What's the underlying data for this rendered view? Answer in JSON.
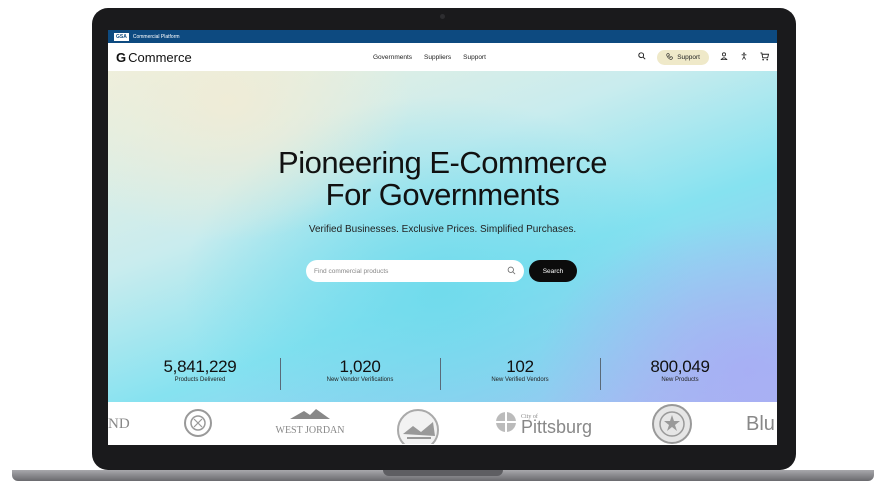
{
  "banner": {
    "badge": "GSA",
    "text": "Commercial Platform"
  },
  "nav": {
    "logo_mark": "G",
    "logo_text": "Commerce",
    "links": [
      "Governments",
      "Suppliers",
      "Support"
    ],
    "search_icon": "search-icon",
    "support_label": "Support",
    "icons": [
      "phone-icon",
      "user-icon",
      "accessibility-icon",
      "cart-icon"
    ]
  },
  "hero": {
    "title_line1": "Pioneering E-Commerce",
    "title_line2": "For Governments",
    "subtitle": "Verified Businesses. Exclusive Prices. Simplified Purchases.",
    "search_placeholder": "Find commercial products",
    "search_button": "Search"
  },
  "stats": [
    {
      "value": "5,841,229",
      "label": "Products Delivered"
    },
    {
      "value": "1,020",
      "label": "New Vendor Verifications"
    },
    {
      "value": "102",
      "label": "New Verified Vendors"
    },
    {
      "value": "800,049",
      "label": "New Products"
    }
  ],
  "logos": {
    "partial_left": "ND",
    "west_jordan": "WEST JORDAN",
    "pittsburgh_prefix": "City of",
    "pittsburgh": "Pittsburg",
    "partial_right": "Blu"
  },
  "colors": {
    "banner": "#0d4a80",
    "search_button": "#0c0c0c",
    "support_pill": "#efe9c9"
  }
}
